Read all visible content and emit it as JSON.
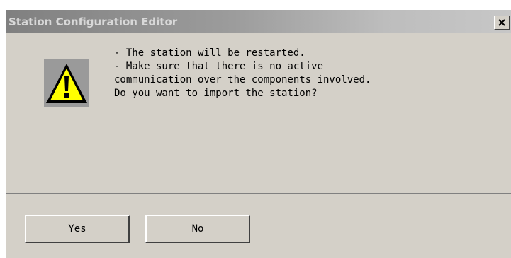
{
  "window": {
    "title": "Station Configuration Editor",
    "close_label": "close"
  },
  "dialog": {
    "icon": "warning-icon",
    "message_lines": [
      "- The station will be restarted.",
      "- Make sure that there is no active",
      "communication over the components involved.",
      "Do you want to import the station?"
    ]
  },
  "buttons": {
    "yes": {
      "accel": "Y",
      "rest": "es"
    },
    "no": {
      "accel": "N",
      "rest": "o"
    }
  },
  "colors": {
    "dialog_bg": "#d4d0c8",
    "title_gradient_start": "#808080",
    "title_gradient_end": "#c7c7c7",
    "title_text": "#d8d8d8",
    "warning_yellow": "#ffff00"
  }
}
